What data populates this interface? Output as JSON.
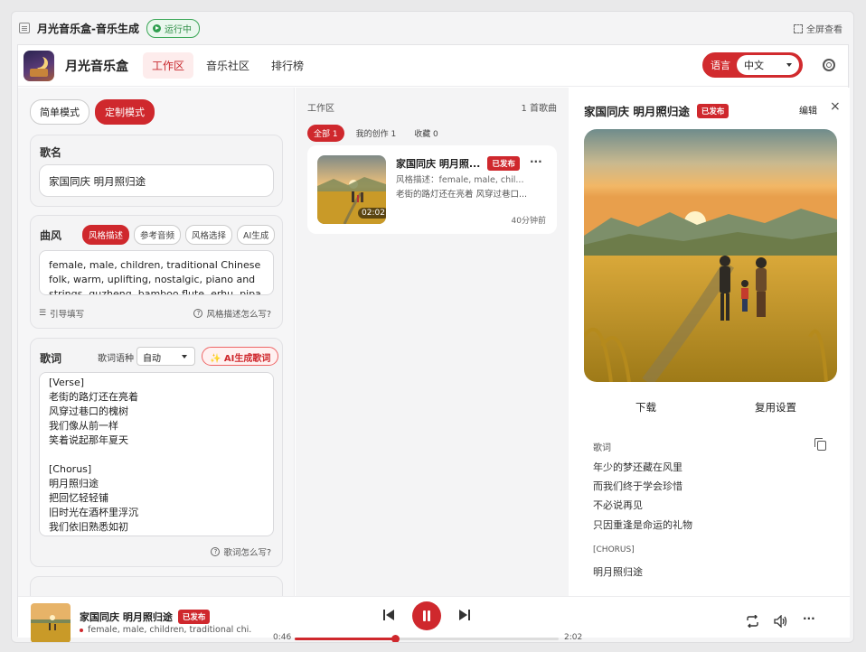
{
  "window": {
    "title": "月光音乐盒-音乐生成",
    "status": "运行中",
    "fullscreen": "全屏查看"
  },
  "nav": {
    "brand": "月光音乐盒",
    "tabs": [
      "工作区",
      "音乐社区",
      "排行榜"
    ],
    "active_tab": 0,
    "lang_label": "语言",
    "lang_value": "中文"
  },
  "left": {
    "modes": [
      "简单模式",
      "定制模式"
    ],
    "song_name_label": "歌名",
    "song_name_value": "家国同庆 明月照归途",
    "style_label": "曲风",
    "style_tabs": [
      "风格描述",
      "参考音频",
      "风格选择",
      "AI生成"
    ],
    "style_text": "female, male, children, traditional Chinese\nfolk, warm, uplifting, nostalgic, piano and\nstrings, guzheng, bamboo flute, erhu, pipa",
    "guide_fill": "引导填写",
    "style_help": "风格描述怎么写?",
    "lyrics_label": "歌词",
    "lyrics_lang_label": "歌词语种",
    "lyrics_lang_value": "自动",
    "ai_lyrics": "✨ AI生成歌词",
    "lyrics_text": "[Verse]\n老街的路灯还在亮着\n风穿过巷口的槐树\n我们像从前一样\n笑着说起那年夏天\n\n[Chorus]\n明月照归途\n把回忆轻轻铺\n旧时光在酒杯里浮沉\n我们依旧熟悉如初",
    "lyrics_help": "歌词怎么写?"
  },
  "middle": {
    "title": "工作区",
    "count": "1 首歌曲",
    "filters": [
      "全部 1",
      "我的创作 1",
      "收藏 0"
    ],
    "song": {
      "title": "家国同庆 明月照...",
      "badge": "已发布",
      "style": "风格描述：female, male, chil...",
      "lyrics": "老街的路灯还在亮着 风穿过巷口...",
      "duration": "02:02",
      "time_ago": "40分钟前",
      "more": "···"
    }
  },
  "right": {
    "title": "家国同庆 明月照归途",
    "badge": "已发布",
    "edit": "编辑",
    "close": "×",
    "download": "下载",
    "reuse": "复用设置",
    "lyrics_label": "歌词",
    "lines": [
      "年少的梦还藏在风里",
      "而我们终于学会珍惜",
      "不必说再见",
      "只因重逢是命运的礼物"
    ],
    "chorus_tag": "[CHORUS]",
    "chorus_line": "明月照归途"
  },
  "player": {
    "title": "家国同庆 明月照归途",
    "badge": "已发布",
    "subtitle": "female, male, children, traditional chi...",
    "current": "0:46",
    "total": "2:02",
    "progress": 0.38,
    "more": "···"
  },
  "colors": {
    "accent": "#cf282d",
    "running": "#2f9e4f"
  }
}
